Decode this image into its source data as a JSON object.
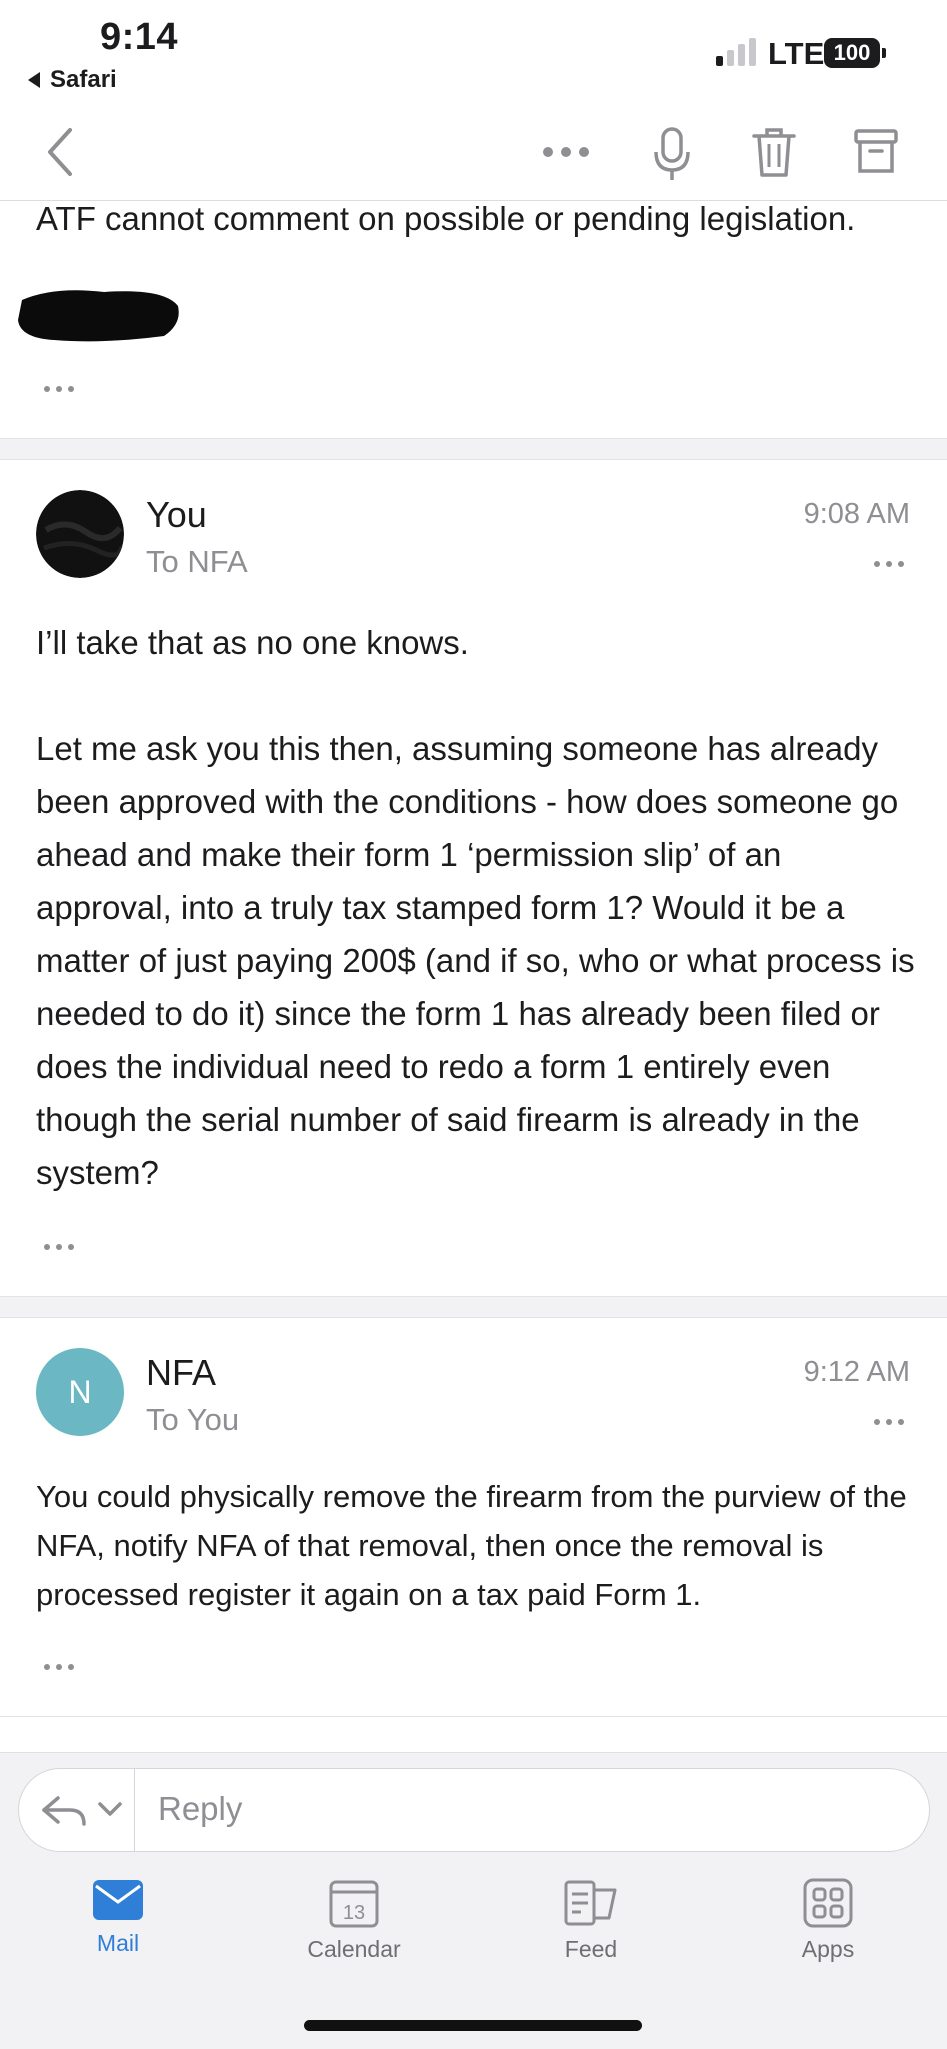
{
  "status_bar": {
    "time": "9:14",
    "back_app": "Safari",
    "network": "LTE",
    "battery": "100"
  },
  "toolbar": {
    "icons": [
      "back-chevron-icon",
      "more-icon",
      "microphone-icon",
      "trash-icon",
      "archive-icon"
    ]
  },
  "messages": [
    {
      "partial": true,
      "body": "ATF cannot comment on possible or pending legislation."
    },
    {
      "sender": "You",
      "to": "To NFA",
      "time": "9:08 AM",
      "avatar_color": "#111111",
      "paragraphs": [
        "I’ll take that as no one knows.",
        "Let me ask you this then, assuming someone has already been approved with the conditions - how does someone go ahead and make their form 1 ‘permission slip’ of an approval, into a truly tax stamped form 1? Would it be a matter of just paying 200$ (and if so, who or what process is needed to do it) since the form 1 has already been filed or does the individual need to redo a form 1 entirely even though the serial number of said firearm is already in the system?"
      ]
    },
    {
      "sender": "NFA",
      "to": "To You",
      "time": "9:12 AM",
      "avatar_initial": "N",
      "avatar_color": "#6bb8c4",
      "paragraphs": [
        "You could physically remove the firearm from the purview of the NFA, notify NFA of that removal, then once the removal is processed register it again on a tax paid Form 1."
      ]
    }
  ],
  "reply": {
    "placeholder": "Reply"
  },
  "tabs": [
    {
      "label": "Mail",
      "icon": "mail-icon",
      "active": true
    },
    {
      "label": "Calendar",
      "icon": "calendar-icon",
      "badge": "13"
    },
    {
      "label": "Feed",
      "icon": "feed-icon"
    },
    {
      "label": "Apps",
      "icon": "apps-grid-icon"
    }
  ],
  "colors": {
    "accent": "#2f7fd8",
    "muted": "#8e8e93"
  }
}
